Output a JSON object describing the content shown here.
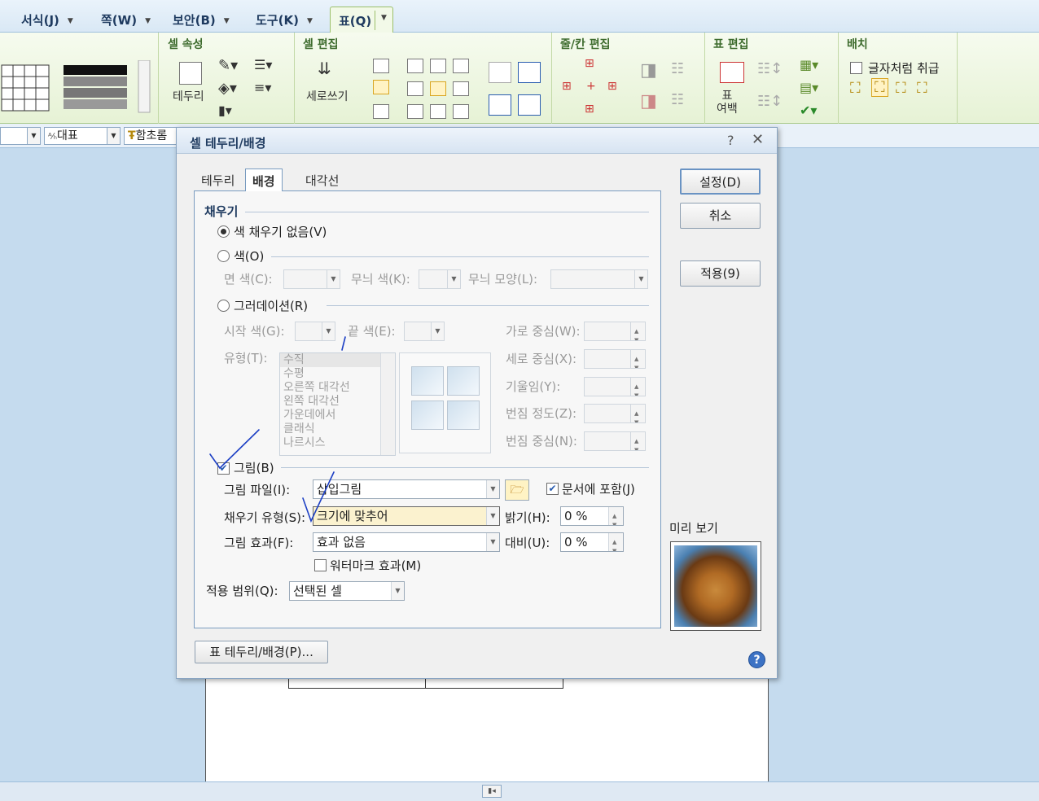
{
  "menubar": {
    "items": [
      "서식(J)",
      "쪽(W)",
      "보안(B)",
      "도구(K)"
    ],
    "active_tab": "표(Q)"
  },
  "ribbon": {
    "groups": [
      "셀 속성",
      "셀 편집",
      "줄/칸 편집",
      "표 편집",
      "배치"
    ],
    "border_label": "테두리",
    "vertical_label": "세로쓰기",
    "margin_label": "표\n여백",
    "char_like_label": "글자처럼 취급"
  },
  "toolbar": {
    "style_combo": "대표",
    "font_combo": "함초롬"
  },
  "dialog": {
    "title": "셀 테두리/배경",
    "help_glyph": "?",
    "close_glyph": "✕",
    "tabs": [
      "테두리",
      "배경",
      "대각선"
    ],
    "buttons": {
      "ok": "설정(D)",
      "cancel": "취소",
      "apply": "적용(9)",
      "table_border": "표 테두리/배경(P)..."
    },
    "fill": {
      "section": "채우기",
      "no_fill": "색 채우기 없음(V)",
      "color": "색(O)",
      "face_color": "면 색(C):",
      "pattern_color": "무늬 색(K):",
      "pattern_shape": "무늬 모양(L):",
      "gradation": "그러데이션(R)",
      "start_color": "시작 색(G):",
      "end_color": "끝 색(E):",
      "type": "유형(T):",
      "type_items": [
        "수직",
        "수평",
        "오른쪽 대각선",
        "왼쪽 대각선",
        "가운데에서",
        "클래식",
        "나르시스"
      ],
      "h_center": "가로 중심(W):",
      "v_center": "세로 중심(X):",
      "tilt": "기울임(Y):",
      "blur": "번짐 정도(Z):",
      "blur_center": "번짐 중심(N):"
    },
    "picture": {
      "checkbox": "그림(B)",
      "file_label": "그림 파일(I):",
      "file_value": "삽입그림",
      "include_doc": "문서에 포함(J)",
      "fill_type_label": "채우기 유형(S):",
      "fill_type_value": "크기에 맞추어",
      "effect_label": "그림 효과(F):",
      "effect_value": "효과 없음",
      "brightness_label": "밝기(H):",
      "brightness_value": "0 %",
      "contrast_label": "대비(U):",
      "contrast_value": "0 %",
      "watermark": "워터마크 효과(M)"
    },
    "scope_label": "적용 범위(Q):",
    "scope_value": "선택된 셀",
    "preview_label": "미리 보기"
  }
}
